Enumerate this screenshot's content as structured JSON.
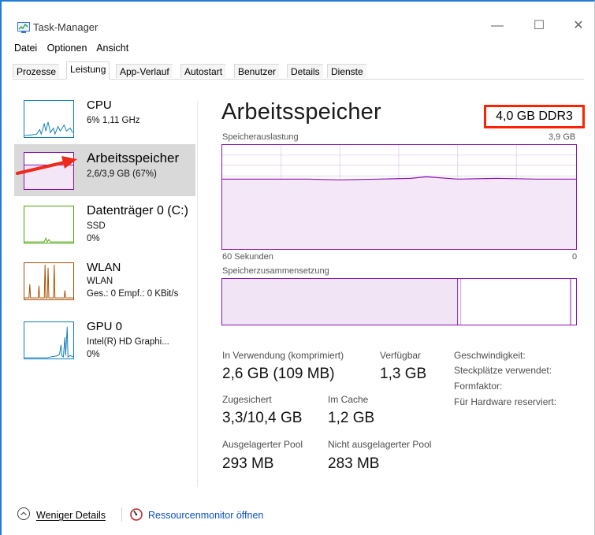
{
  "window": {
    "title": "Task-Manager",
    "minimize": "—",
    "maximize": "☐",
    "close": "✕"
  },
  "menu": {
    "items": [
      "Datei",
      "Optionen",
      "Ansicht"
    ]
  },
  "tabs": [
    "Prozesse",
    "Leistung",
    "App-Verlauf",
    "Autostart",
    "Benutzer",
    "Details",
    "Dienste"
  ],
  "active_tab": "Leistung",
  "sidebar": {
    "items": [
      {
        "name": "CPU",
        "sub1": "6% 1,11 GHz",
        "sub2": "",
        "sub3": "",
        "color": "#117dbb"
      },
      {
        "name": "Arbeitsspeicher",
        "sub1": "2,6/3,9 GB (67%)",
        "sub2": "",
        "sub3": "",
        "color": "#8b12ae",
        "level": 0.67
      },
      {
        "name": "Datenträger 0 (C:)",
        "sub1": "SSD",
        "sub2": "0%",
        "sub3": "",
        "color": "#4da60c"
      },
      {
        "name": "WLAN",
        "sub1": "WLAN",
        "sub2": "Ges.: 0 Empf.: 0 KBit/s",
        "sub3": "",
        "color": "#a74f01"
      },
      {
        "name": "GPU 0",
        "sub1": "Intel(R) HD Graphi...",
        "sub2": "0%",
        "sub3": "",
        "color": "#117dbb"
      }
    ]
  },
  "main": {
    "title": "Arbeitsspeicher",
    "spec": "4,0 GB DDR3",
    "graph_label": "Speicherauslastung",
    "graph_max": "3,9 GB",
    "graph_time": "60 Sekunden",
    "graph_min": "0",
    "composition_label": "Speicherzusammensetzung",
    "usage_level": 0.67
  },
  "stats": {
    "in_use_label": "In Verwendung (komprimiert)",
    "in_use_value": "2,6 GB (109 MB)",
    "available_label": "Verfügbar",
    "available_value": "1,3 GB",
    "committed_label": "Zugesichert",
    "committed_value": "3,3/10,4 GB",
    "cached_label": "Im Cache",
    "cached_value": "1,2 GB",
    "paged_label": "Ausgelagerter Pool",
    "paged_value": "293 MB",
    "nonpaged_label": "Nicht ausgelagerter Pool",
    "nonpaged_value": "283 MB",
    "speed_label": "Geschwindigkeit:",
    "slots_label": "Steckplätze verwendet:",
    "form_label": "Formfaktor:",
    "reserved_label": "Für Hardware reserviert:"
  },
  "footer": {
    "less_details": "Weniger Details",
    "resource_monitor": "Ressourcenmonitor öffnen"
  },
  "colors": {
    "memory": "#8b12ae",
    "cpu": "#117dbb",
    "disk": "#4da60c",
    "network": "#a74f01",
    "highlight": "#ff2200",
    "link": "#0a4fc4"
  }
}
